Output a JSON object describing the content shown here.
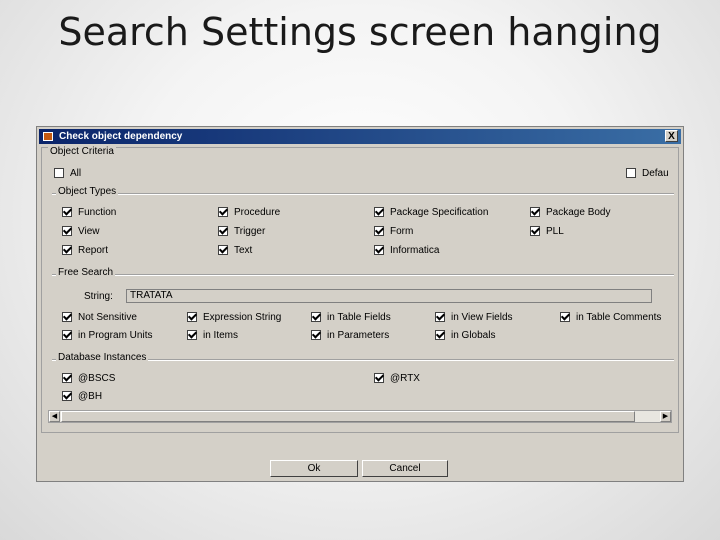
{
  "slide_title": "Search Settings screen hanging",
  "dialog": {
    "title": "Check object dependency",
    "close_label": "X",
    "object_criteria": {
      "label": "Object Criteria",
      "all": {
        "label": "All",
        "checked": false
      },
      "default": {
        "label": "Defau",
        "checked": false
      }
    },
    "object_types": {
      "label": "Object Types",
      "items": [
        {
          "label": "Function",
          "checked": true
        },
        {
          "label": "Procedure",
          "checked": true
        },
        {
          "label": "Package Specification",
          "checked": true
        },
        {
          "label": "Package Body",
          "checked": true
        },
        {
          "label": "View",
          "checked": true
        },
        {
          "label": "Trigger",
          "checked": true
        },
        {
          "label": "Form",
          "checked": true
        },
        {
          "label": "PLL",
          "checked": true
        },
        {
          "label": "Report",
          "checked": true
        },
        {
          "label": "Text",
          "checked": true
        },
        {
          "label": "Informatica",
          "checked": true
        }
      ]
    },
    "free_search": {
      "label": "Free Search",
      "string_label": "String:",
      "string_value": "TRATATA",
      "options": [
        {
          "label": "Not Sensitive",
          "checked": true
        },
        {
          "label": "Expression String",
          "checked": true
        },
        {
          "label": "in Table Fields",
          "checked": true
        },
        {
          "label": "in View Fields",
          "checked": true
        },
        {
          "label": "in Table Comments",
          "checked": true
        },
        {
          "label": "in Program Units",
          "checked": true
        },
        {
          "label": "in Items",
          "checked": true
        },
        {
          "label": "in Parameters",
          "checked": true
        },
        {
          "label": "in Globals",
          "checked": true
        }
      ]
    },
    "database_instances": {
      "label": "Database Instances",
      "items": [
        {
          "label": "@BSCS",
          "checked": true
        },
        {
          "label": "@RTX",
          "checked": true
        },
        {
          "label": "@BH",
          "checked": true
        }
      ]
    },
    "ok_label": "Ok",
    "cancel_label": "Cancel"
  }
}
